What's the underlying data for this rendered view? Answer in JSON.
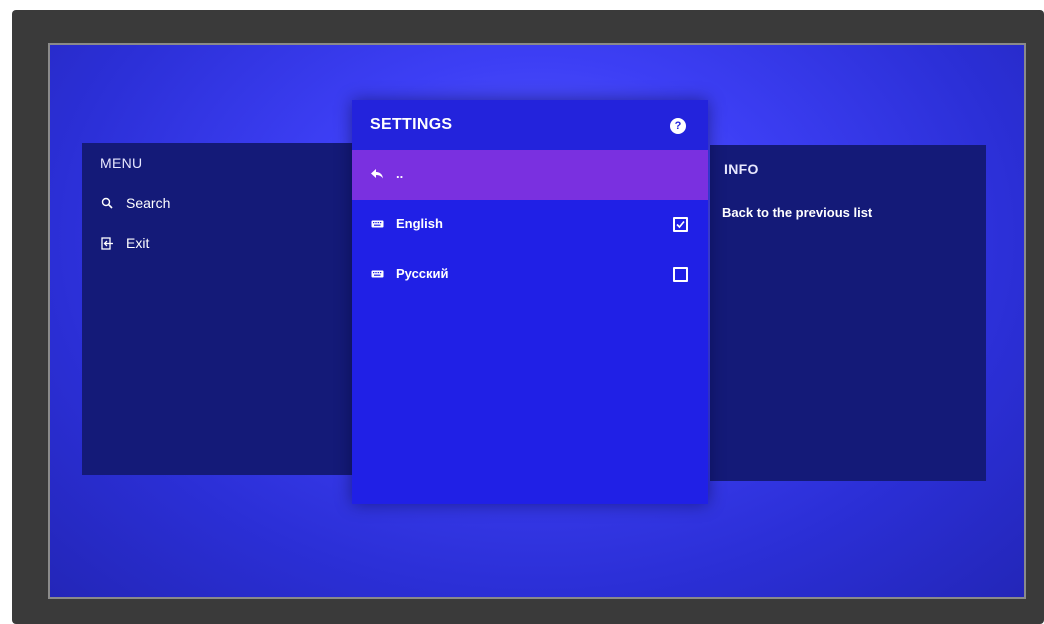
{
  "menu": {
    "title": "MENU",
    "items": [
      {
        "label": "Search",
        "icon": "search-icon"
      },
      {
        "label": "Exit",
        "icon": "exit-icon"
      }
    ]
  },
  "settings": {
    "title": "SETTINGS",
    "help_glyph": "?",
    "back_item": {
      "label": "..",
      "icon": "back-arrow-icon",
      "selected": true
    },
    "languages": [
      {
        "label": "English",
        "icon": "keyboard-icon",
        "checked": true
      },
      {
        "label": "Русский",
        "icon": "keyboard-icon",
        "checked": false
      }
    ]
  },
  "info": {
    "title": "INFO",
    "text": "Back to the previous list"
  },
  "colors": {
    "background": "#3d3ff5",
    "side_panel": "#141a78",
    "settings_panel": "#2020e6",
    "selection": "#7a30e0"
  }
}
